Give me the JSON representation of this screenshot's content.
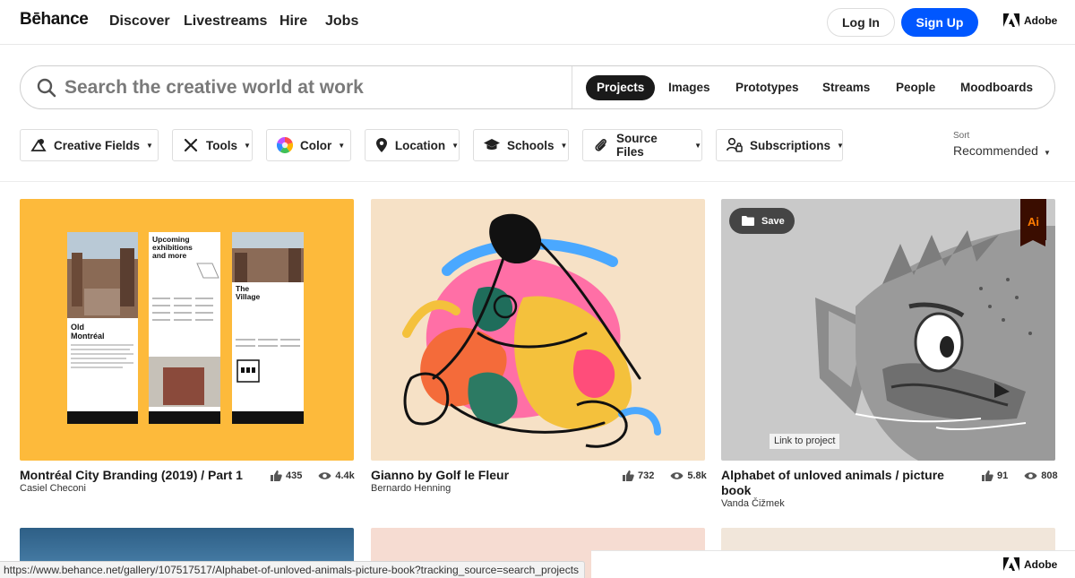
{
  "nav": {
    "logo": "Bēhance",
    "links": [
      "Discover",
      "Livestreams",
      "Hire",
      "Jobs"
    ],
    "login": "Log In",
    "signup": "Sign Up",
    "adobe": "Adobe"
  },
  "search": {
    "placeholder": "Search the creative world at work",
    "tabs": [
      "Projects",
      "Images",
      "Prototypes",
      "Streams",
      "People",
      "Moodboards"
    ],
    "active_tab": "Projects"
  },
  "filters": [
    {
      "label": "Creative Fields",
      "icon": "creative-fields-icon"
    },
    {
      "label": "Tools",
      "icon": "tools-icon"
    },
    {
      "label": "Color",
      "icon": "color-wheel-icon"
    },
    {
      "label": "Location",
      "icon": "location-pin-icon"
    },
    {
      "label": "Schools",
      "icon": "graduation-cap-icon"
    },
    {
      "label": "Source Files",
      "icon": "paperclip-icon"
    },
    {
      "label": "Subscriptions",
      "icon": "subscriptions-icon"
    }
  ],
  "sort": {
    "label": "Sort",
    "value": "Recommended"
  },
  "projects": [
    {
      "title": "Montréal City Branding (2019) / Part 1",
      "owner": "Casiel Checoni",
      "likes": "435",
      "views": "4.4k",
      "bg": "#fdba3b",
      "poster_texts": [
        "Upcoming exhibitions and more",
        "Old Montréal",
        "The Village"
      ]
    },
    {
      "title": "Gianno by Golf le Fleur",
      "owner": "Bernardo Henning",
      "likes": "732",
      "views": "5.8k",
      "bg": "#f6e1c6"
    },
    {
      "title": "Alphabet of unloved animals / picture book",
      "owner": "Vanda Čižmek",
      "likes": "91",
      "views": "808",
      "bg": "#c9c9c9",
      "save_label": "Save",
      "badge": "Ai",
      "tooltip": "Link to project"
    }
  ],
  "status_url": "https://www.behance.net/gallery/107517517/Alphabet-of-unloved-animals-picture-book?tracking_source=search_projects",
  "colors": {
    "primary": "#0057ff",
    "accent_card1": "#fdba3b"
  }
}
